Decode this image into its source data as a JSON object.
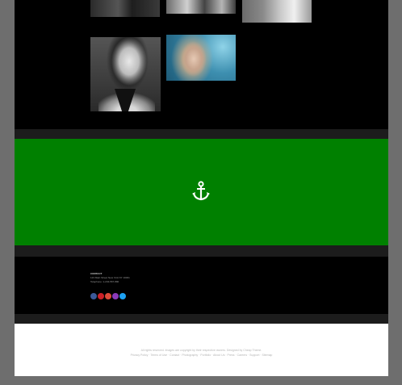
{
  "gallery": {
    "top_row": [
      "gallery-photo-1",
      "gallery-photo-2",
      "gallery-photo-3"
    ],
    "bottom_row": [
      "portrait-photo",
      "blonde-portrait-photo"
    ]
  },
  "feature_band": {
    "icon": "anchor-icon",
    "background_color": "#008000"
  },
  "footer": {
    "address_title": "CONTACT",
    "address_line": "123 Main Street New York NY 10001",
    "phone_line": "Telephone: 1-234-567-890",
    "socials": [
      {
        "name": "facebook-icon",
        "color": "#3b5998"
      },
      {
        "name": "pinterest-icon",
        "color": "#cb2027"
      },
      {
        "name": "google-plus-icon",
        "color": "#dd4b39"
      },
      {
        "name": "instagram-icon",
        "color": "#8a3ab9"
      },
      {
        "name": "twitter-icon",
        "color": "#1da1f2"
      }
    ],
    "copyright_1": "All rights reserved. Images are copyright by their respective owners. Designed by Cheap Theme.",
    "copyright_2": "Privacy Policy · Terms of Use · Contact · Photography · Portfolio · About Us · Press · Careers · Support · Sitemap"
  }
}
